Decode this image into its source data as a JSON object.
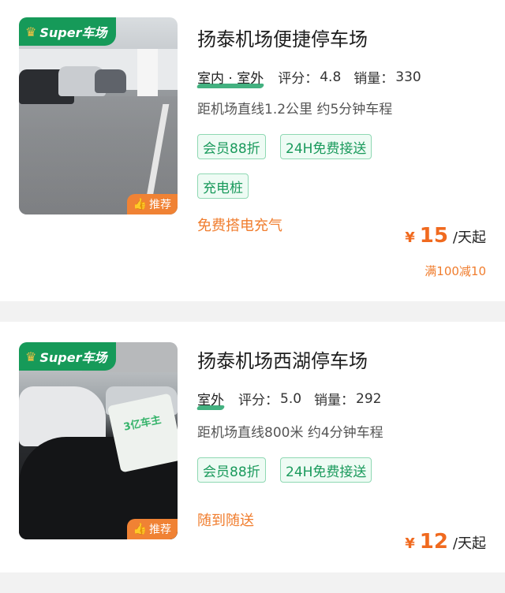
{
  "listings": [
    {
      "badge": "Super车场",
      "recommend": "推荐",
      "name": "扬泰机场便捷停车场",
      "type": "室内 · 室外",
      "rating_label": "评分：",
      "rating": "4.8",
      "sales_label": "销量：",
      "sales": "330",
      "distance": "距机场直线1.2公里 约5分钟车程",
      "tags": [
        "会员88折",
        "24H免费接送",
        "充电桩"
      ],
      "service": "免费搭电充气",
      "currency": "¥",
      "price": "15",
      "price_unit": "/天起",
      "discount": "满100减10"
    },
    {
      "badge": "Super车场",
      "recommend": "推荐",
      "name": "扬泰机场西湖停车场",
      "type": "室外",
      "rating_label": "评分：",
      "rating": "5.0",
      "sales_label": "销量：",
      "sales": "292",
      "distance": "距机场直线800米 约4分钟车程",
      "tags": [
        "会员88折",
        "24H免费接送"
      ],
      "service": "随到随送",
      "currency": "¥",
      "price": "12",
      "price_unit": "/天起",
      "photo_text": "3亿车主"
    }
  ],
  "colors": {
    "brand_green": "#169a59",
    "accent_orange": "#f06a1f",
    "tag_green": "#1a9a5c"
  }
}
